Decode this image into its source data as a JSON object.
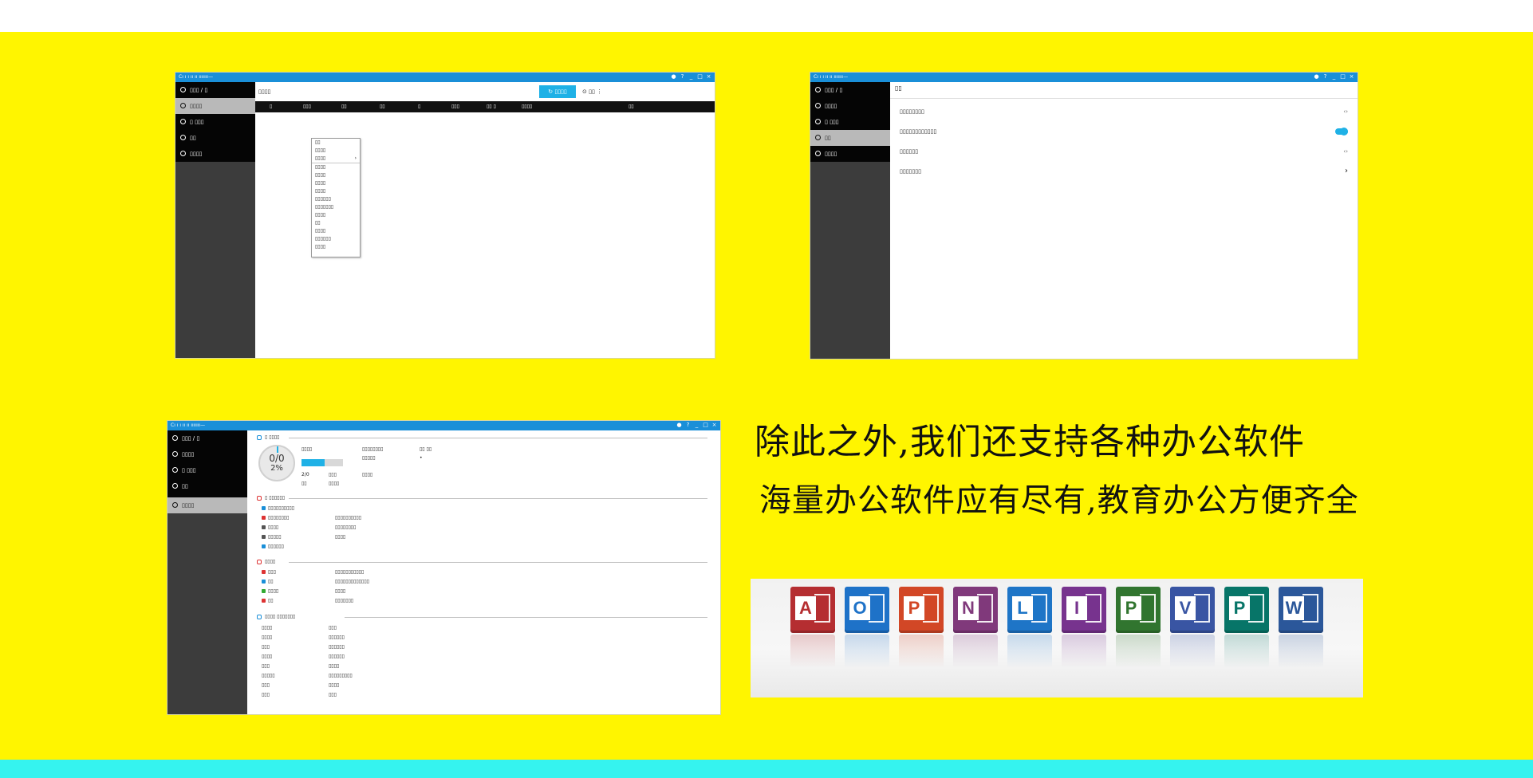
{
  "colors": {
    "background_yellow": "#fff500",
    "bottom_band": "#35f3ef",
    "titlebar_blue": "#1a8fd8",
    "sidebar_dark": "#3c3c3c",
    "accent_cyan": "#1fb1e6"
  },
  "headline": "除此之外,我们还支持各种办公软件",
  "subline": "海量办公软件应有尽有,教育办公方便齐全",
  "window_controls": [
    "●",
    "?",
    "_",
    "□",
    "×"
  ],
  "screenshot_fm": {
    "title": "Cı ı ı ıı ıı ııııııı—",
    "sidebar": [
      {
        "icon": "circle-icon",
        "label": "▯▯▯ / ▯"
      },
      {
        "icon": "disk-icon",
        "label": "▯▯▯▯"
      },
      {
        "icon": "drive-icon",
        "label": "▯ ▯▯▯"
      },
      {
        "icon": "gear-icon",
        "label": "▯▯"
      },
      {
        "icon": "info-icon",
        "label": "▯▯▯▯"
      }
    ],
    "path": "▯▯▯▯",
    "toolbar_button": "↻  ▯▯▯▯",
    "toolbar_extra": "⊙  ▯▯  ⋮",
    "columns": [
      "▯",
      "▯▯▯",
      "▯▯",
      "▯▯",
      "▯",
      "▯▯▯",
      "▯▯ ▯",
      "▯▯▯▯",
      "▯▯"
    ],
    "context_menu": [
      "▯▯",
      "▯▯▯▯",
      "▯▯▯▯",
      "▯▯▯▯",
      "▯▯▯▯",
      "▯▯▯▯",
      "▯▯▯▯",
      "▯▯▯▯▯▯",
      "▯▯▯▯▯▯▯",
      "▯▯▯▯",
      "▯▯",
      "▯▯▯▯",
      "▯▯▯▯▯▯",
      "▯▯▯▯"
    ]
  },
  "screenshot_settings": {
    "title": "Cı ı ı ıı ıı ııııııı—",
    "sidebar": [
      {
        "icon": "circle-icon",
        "label": "▯▯▯ / ▯"
      },
      {
        "icon": "disk-icon",
        "label": "▯▯▯▯"
      },
      {
        "icon": "drive-icon",
        "label": "▯ ▯▯▯"
      },
      {
        "icon": "gear-icon",
        "label": "▯▯"
      },
      {
        "icon": "info-icon",
        "label": "▯▯▯▯"
      }
    ],
    "heading": "▯▯",
    "rows": [
      {
        "label": "▯▯▯▯▯▯▯▯",
        "control": "‹›"
      },
      {
        "label": "▯▯▯▯▯▯▯▯▯▯▯▯",
        "control": "toggle"
      },
      {
        "label": "▯▯▯▯▯▯",
        "control": "‹›"
      },
      {
        "label": "▯▯▯▯▯▯▯",
        "control": "›"
      }
    ]
  },
  "screenshot_about": {
    "title": "Cı ı ı ıı ıı ııııııı—",
    "sidebar": [
      {
        "icon": "circle-icon",
        "label": "▯▯▯ / ▯"
      },
      {
        "icon": "disk-icon",
        "label": "▯▯▯▯"
      },
      {
        "icon": "drive-icon",
        "label": "▯ ▯▯▯"
      },
      {
        "icon": "gear-icon",
        "label": "▯▯"
      },
      {
        "icon": "info-icon",
        "label": "▯▯▯▯"
      }
    ],
    "gauge_top": "0/0",
    "gauge_bottom": "2%",
    "storage_progress": 0.55,
    "system_heading": "▯ ▯▯▯▯",
    "system_stats": [
      [
        "▯▯▯▯",
        "▯▯▯▯▯▯▯▯",
        "▯▯ ▯▯"
      ],
      [
        "",
        "▯▯▯▯▯",
        "•"
      ],
      [
        "2/0",
        "▯▯▯",
        "▯▯▯▯"
      ],
      [
        "▯▯",
        "▯▯▯▯",
        ""
      ]
    ],
    "sections": [
      {
        "heading": "▯ ▯▯▯▯▯▯",
        "rows": [
          [
            "▯▯▯▯▯▯▯▯▯▯",
            ""
          ],
          [
            "▯▯▯▯▯▯▯▯",
            "▯▯▯▯▯▯▯▯▯▯"
          ],
          [
            "▯▯▯▯",
            "▯▯▯▯▯▯▯▯"
          ],
          [
            "▯▯▯▯▯",
            "▯▯▯▯"
          ],
          [
            "▯▯▯▯▯▯",
            ""
          ]
        ]
      },
      {
        "heading": "▯▯▯▯",
        "rows": [
          [
            "▯▯▯",
            "▯▯▯▯▯▯▯▯▯▯▯"
          ],
          [
            "▯▯",
            "▯▯▯▯▯▯▯▯▯▯▯▯▯"
          ],
          [
            "▯▯▯▯",
            "▯▯▯▯"
          ],
          [
            "▯▯",
            "▯▯▯▯▯▯▯"
          ]
        ]
      },
      {
        "heading": "▯▯▯▯ ▯▯▯▯▯▯▯",
        "rows": [
          [
            "▯▯▯▯",
            "▯▯▯"
          ],
          [
            "▯▯▯▯",
            "▯▯▯▯▯▯"
          ],
          [
            "▯▯▯",
            "▯▯▯▯▯▯"
          ],
          [
            "▯▯▯▯",
            "▯▯▯▯▯▯"
          ],
          [
            "▯▯▯",
            "▯▯▯▯"
          ],
          [
            "▯▯▯▯▯",
            "▯▯▯▯▯▯▯▯▯"
          ],
          [
            "▯▯▯",
            "▯▯▯▯"
          ],
          [
            "▯▯▯",
            "▯▯▯"
          ]
        ]
      }
    ]
  },
  "office_apps": [
    {
      "letter": "A",
      "icon": "access-icon",
      "color": "#b52e31"
    },
    {
      "letter": "O",
      "icon": "outlook-icon",
      "color": "#1e72c8"
    },
    {
      "letter": "P",
      "icon": "powerpoint-icon",
      "color": "#d24726"
    },
    {
      "letter": "N",
      "icon": "onenote-icon",
      "color": "#80397b"
    },
    {
      "letter": "L",
      "icon": "lync-icon",
      "color": "#1e75c7"
    },
    {
      "letter": "I",
      "icon": "infopath-icon",
      "color": "#77338e"
    },
    {
      "letter": "P",
      "icon": "project-icon",
      "color": "#31752f"
    },
    {
      "letter": "V",
      "icon": "visio-icon",
      "color": "#3955a3"
    },
    {
      "letter": "P",
      "icon": "publisher-icon",
      "color": "#077568"
    },
    {
      "letter": "W",
      "icon": "word-icon",
      "color": "#2b579a"
    }
  ]
}
